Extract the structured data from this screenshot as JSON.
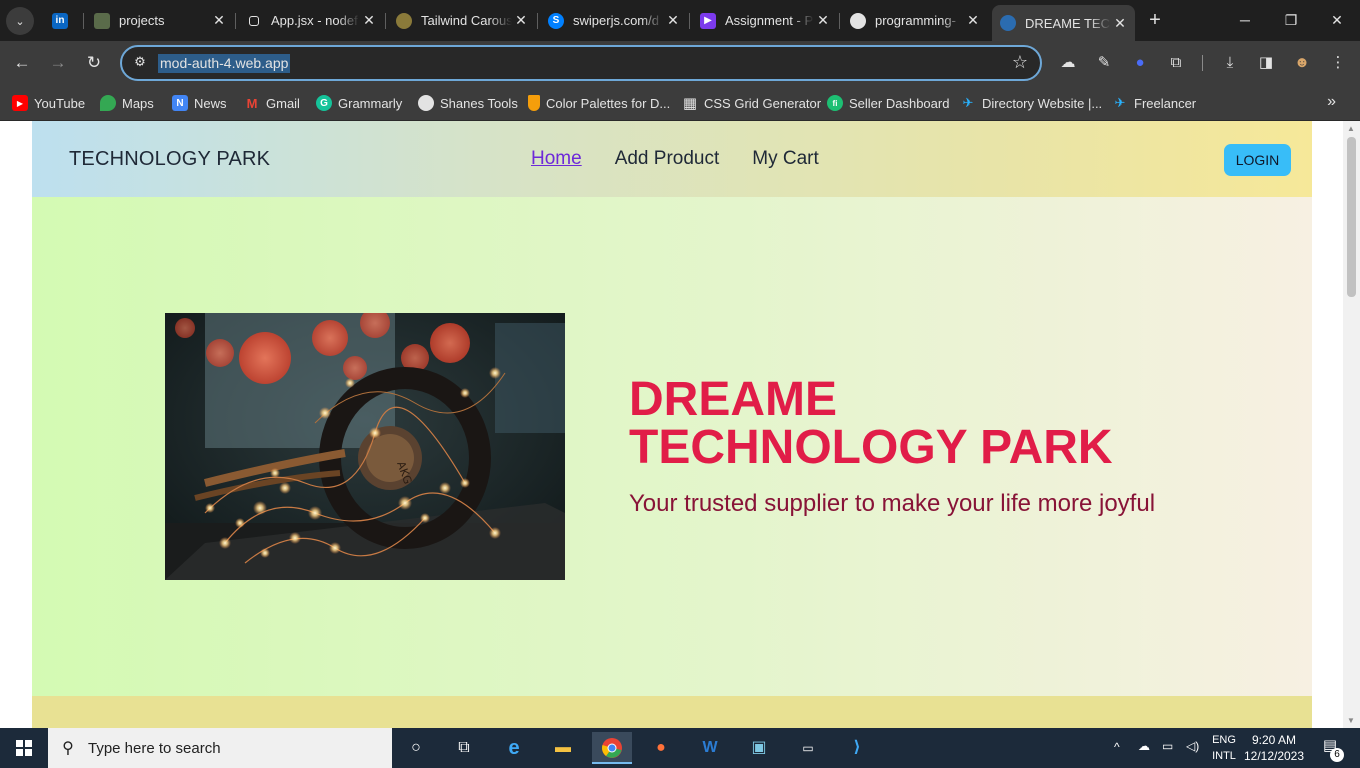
{
  "browser": {
    "tabs": [
      {
        "title": "",
        "favicon": "linkedin-icon",
        "color": "#0a66c2",
        "glyph": "in"
      },
      {
        "title": "projects",
        "favicon": "folder-avatar-icon",
        "color": "#5a6b4a",
        "glyph": ""
      },
      {
        "title": "App.jsx - nodef",
        "favicon": "page-icon",
        "color": "#3c3c3c",
        "glyph": "▢"
      },
      {
        "title": "Tailwind Carousel",
        "favicon": "tailwind-icon",
        "color": "#3c3c3c",
        "glyph": "♙"
      },
      {
        "title": "swiperjs.com/d",
        "favicon": "swiper-icon",
        "color": "#0080ff",
        "glyph": "S"
      },
      {
        "title": "Assignment - P",
        "favicon": "assignment-icon",
        "color": "#7c3aed",
        "glyph": "▶"
      },
      {
        "title": "programming-",
        "favicon": "github-icon",
        "color": "#3c3c3c",
        "glyph": "●"
      },
      {
        "title": "DREAME TECH",
        "favicon": "globe-icon",
        "color": "#2b6cb0",
        "glyph": "◍"
      }
    ],
    "url": "mod-auth-4.web.app",
    "bookmarks": [
      {
        "label": "YouTube",
        "icon": "youtube-icon",
        "color": "#ff0000",
        "glyph": "▶"
      },
      {
        "label": "Maps",
        "icon": "maps-icon",
        "color": "#34a853",
        "glyph": "⬤"
      },
      {
        "label": "News",
        "icon": "news-icon",
        "color": "#4285f4",
        "glyph": "N"
      },
      {
        "label": "Gmail",
        "icon": "gmail-icon",
        "color": "#ea4335",
        "glyph": "M"
      },
      {
        "label": "Grammarly",
        "icon": "grammarly-icon",
        "color": "#15c39a",
        "glyph": "G"
      },
      {
        "label": "Shanes Tools",
        "icon": "globe-icon",
        "color": "#e3e3e3",
        "glyph": "◍"
      },
      {
        "label": "Color Palettes for D...",
        "icon": "palette-icon",
        "color": "#f59e0b",
        "glyph": "▾"
      },
      {
        "label": "CSS Grid Generator",
        "icon": "grid-icon",
        "color": "#e3e3e3",
        "glyph": "▦"
      },
      {
        "label": "Seller Dashboard",
        "icon": "fiverr-icon",
        "color": "#1dbf73",
        "glyph": "fi"
      },
      {
        "label": "Directory Website |...",
        "icon": "bird-icon",
        "color": "#29b2fe",
        "glyph": "✈"
      },
      {
        "label": "Freelancer",
        "icon": "bird-icon",
        "color": "#29b2fe",
        "glyph": "✈"
      }
    ]
  },
  "site": {
    "brand": "TECHNOLOGY PARK",
    "nav": [
      "Home",
      "Add Product",
      "My Cart"
    ],
    "login": "LOGIN",
    "hero": {
      "title_line1": "DREAME",
      "title_line2": "TECHNOLOGY PARK",
      "subtitle": "Your trusted supplier to make your life more joyful",
      "image": "headphones-with-fairy-lights-image"
    }
  },
  "taskbar": {
    "search_placeholder": "Type here to search",
    "lang1": "ENG",
    "lang2": "INTL",
    "time": "9:20 AM",
    "date": "12/12/2023",
    "notifications": "6"
  }
}
